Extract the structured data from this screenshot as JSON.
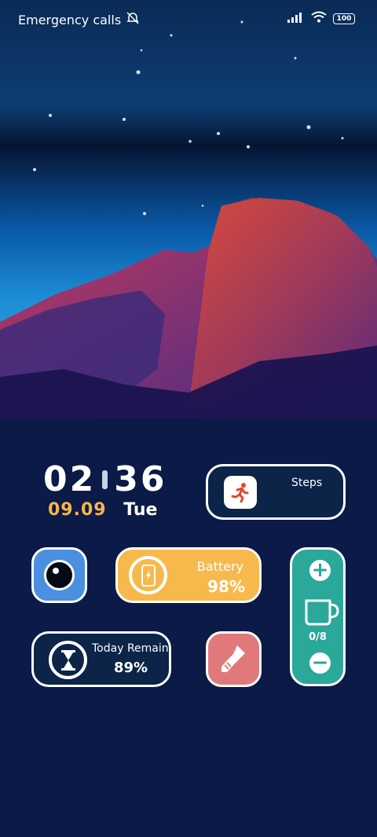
{
  "status_bar": {
    "left_text": "Emergency calls",
    "battery_level": "100",
    "icons": [
      "mute-icon",
      "signal-icon",
      "wifi-icon",
      "battery-icon"
    ]
  },
  "clock": {
    "time_hours": "02",
    "time_minutes": "36",
    "date": "09.09",
    "weekday": "Tue"
  },
  "widgets": {
    "steps": {
      "label": "Steps",
      "icon": "running-person-icon"
    },
    "camera": {
      "icon": "camera-lens-icon"
    },
    "battery": {
      "label": "Battery",
      "value": "98%",
      "icon": "phone-charging-icon",
      "color": "#f7b94b"
    },
    "water": {
      "count": "0/8",
      "icon": "cup-icon",
      "color": "#2aa89a"
    },
    "today_remain": {
      "label": "Today Remain",
      "value": "89%",
      "icon": "hourglass-icon"
    },
    "cleaner": {
      "icon": "broom-icon",
      "color": "#e07a7a"
    }
  }
}
